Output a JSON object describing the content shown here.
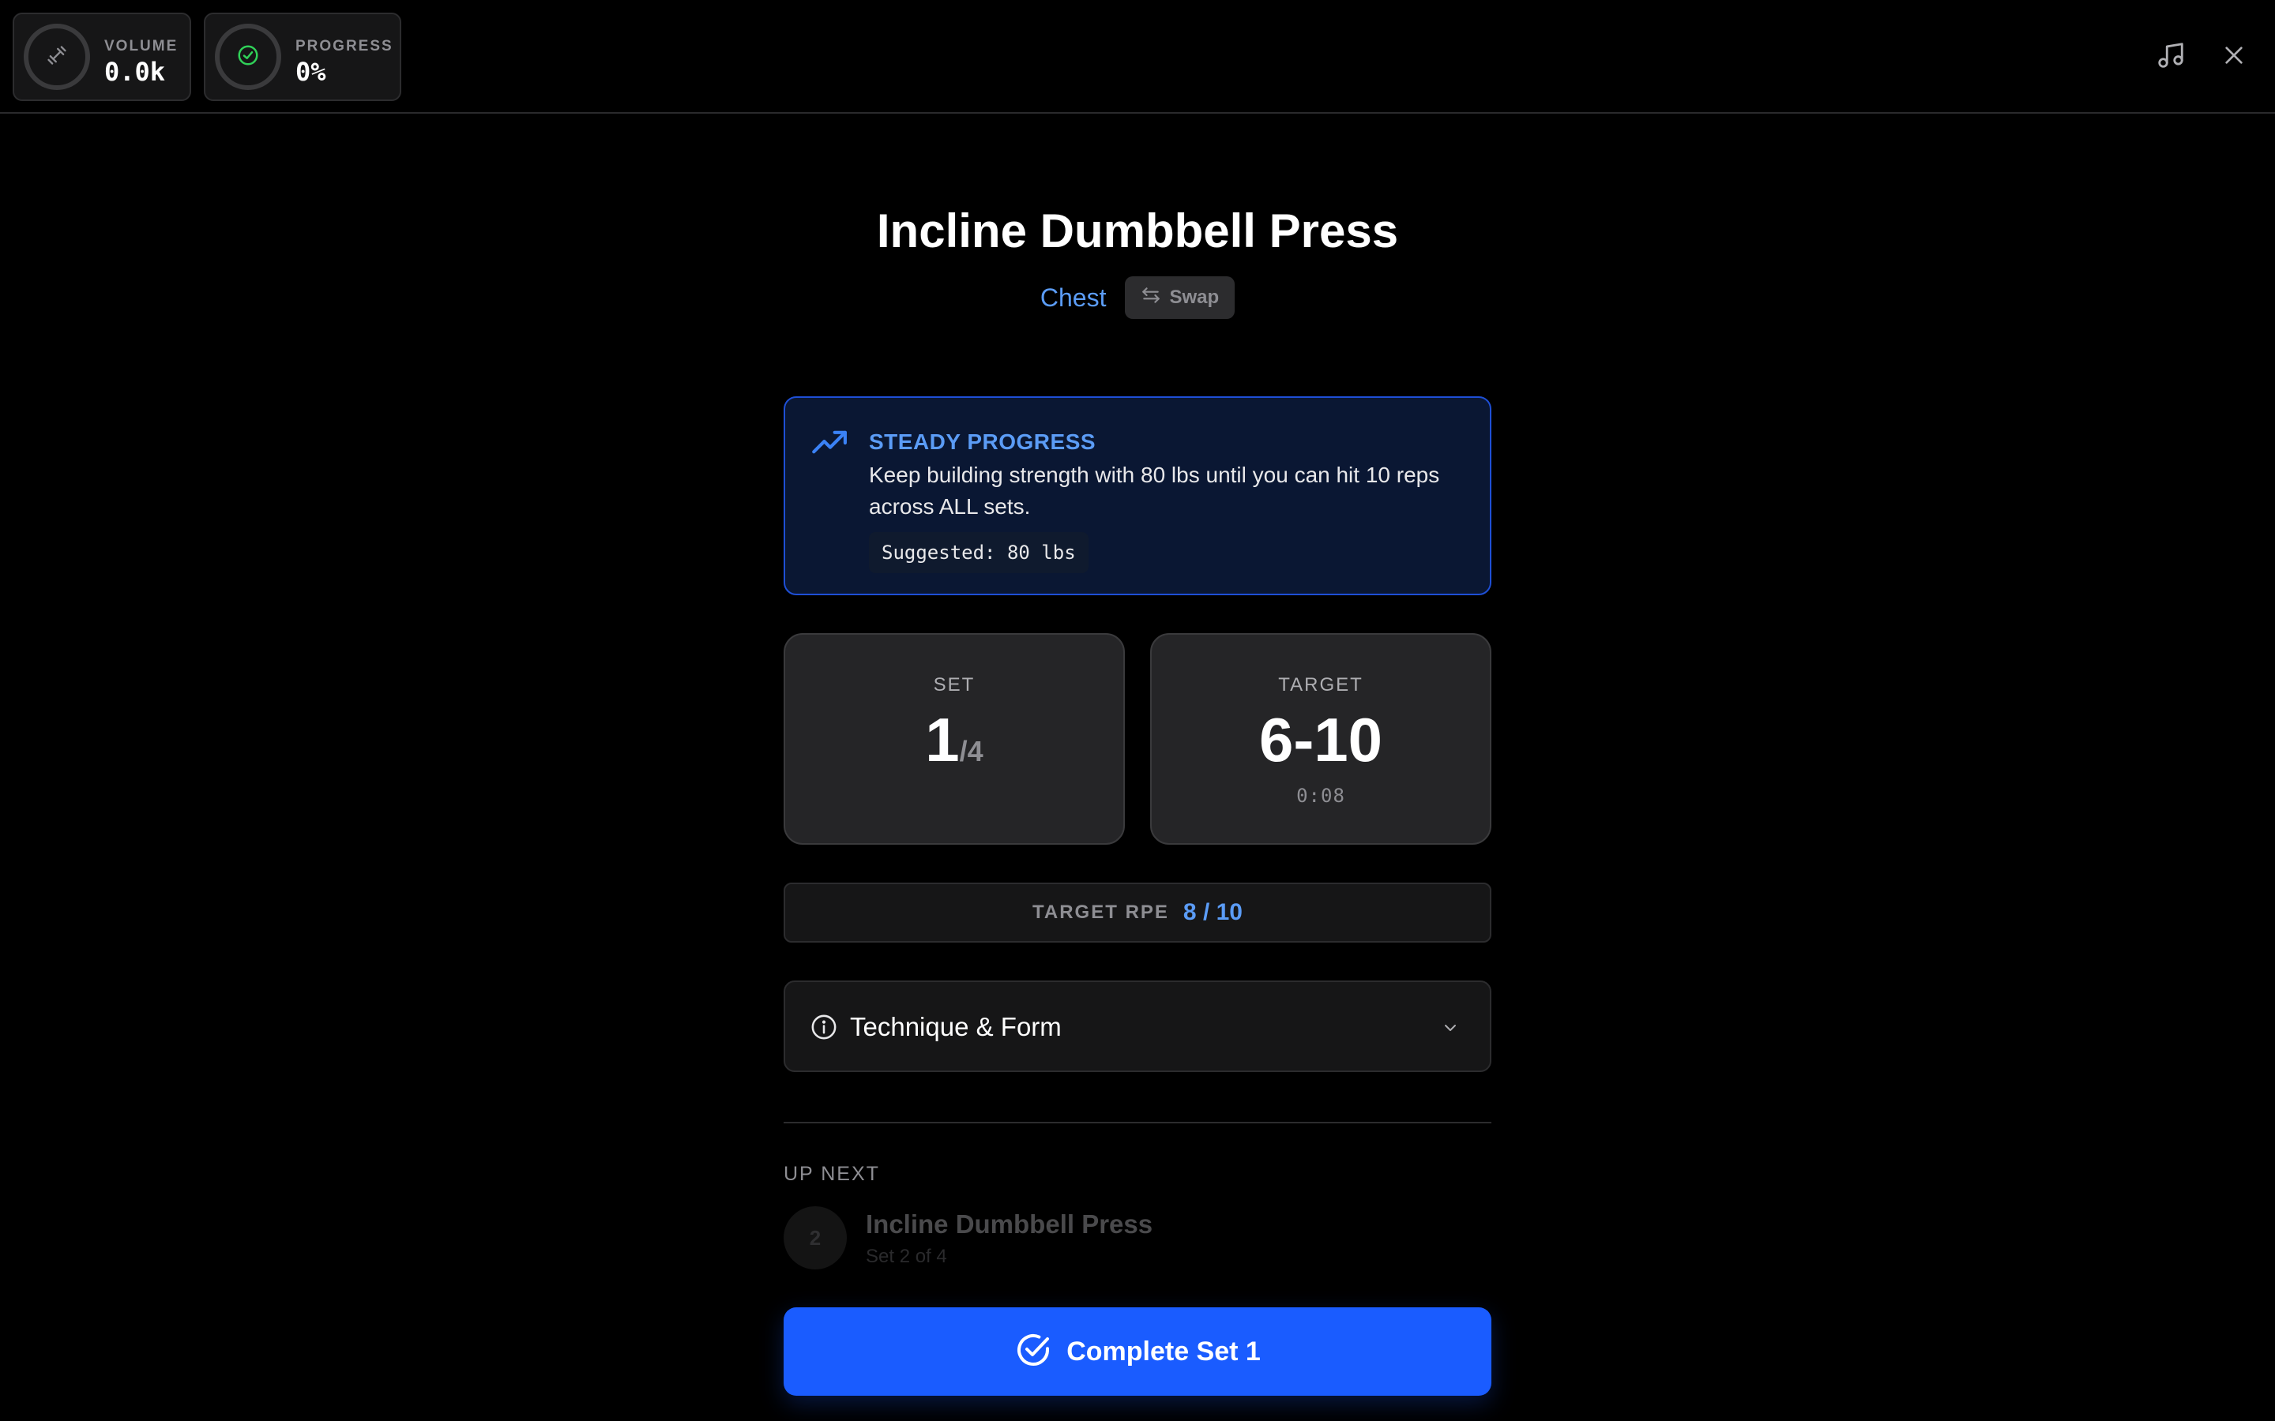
{
  "stats": {
    "volume": {
      "label": "VOLUME",
      "value": "0.0k",
      "icon": "dumbbell-icon"
    },
    "progress": {
      "label": "PROGRESS",
      "value": "0%",
      "icon": "check-circle-icon",
      "fraction": 0
    }
  },
  "top_actions": {
    "music_icon": "music-note-icon",
    "close_icon": "close-icon"
  },
  "exercise": {
    "title": "Incline Dumbbell Press",
    "muscle": "Chest",
    "swap_label": "Swap"
  },
  "progression": {
    "title": "STEADY PROGRESS",
    "message": "Keep building strength with 80 lbs until you can hit 10 reps across ALL sets.",
    "suggestion": "Suggested: 80 lbs",
    "icon": "trending-up-icon"
  },
  "set_card": {
    "label": "SET",
    "current": "1",
    "total": "/4"
  },
  "target_card": {
    "label": "TARGET",
    "reps": "6-10",
    "timer": "0:08"
  },
  "rpe": {
    "label": "TARGET RPE",
    "value": "8 / 10"
  },
  "technique": {
    "label": "Technique & Form"
  },
  "up_next": {
    "label": "UP NEXT",
    "badge": "2",
    "name": "Incline Dumbbell Press",
    "detail": "Set 2 of 4"
  },
  "complete_button": {
    "label": "Complete Set 1"
  },
  "colors": {
    "accent": "#1a5cff",
    "accent_text": "#5b9cf6",
    "success": "#30d158",
    "background": "#000000"
  }
}
